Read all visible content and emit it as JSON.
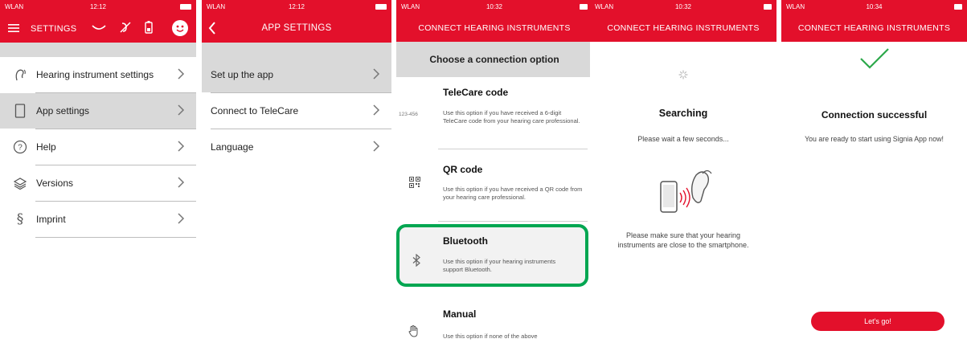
{
  "screen1": {
    "status": {
      "carrier": "WLAN",
      "time": "12:12"
    },
    "title": "SETTINGS",
    "items": [
      {
        "label": "Hearing instrument settings",
        "icon": "ear-icon"
      },
      {
        "label": "App settings",
        "icon": "phone-icon"
      },
      {
        "label": "Help",
        "icon": "help-icon"
      },
      {
        "label": "Versions",
        "icon": "layers-icon"
      },
      {
        "label": "Imprint",
        "icon": "section-icon"
      }
    ]
  },
  "screen2": {
    "status": {
      "carrier": "WLAN",
      "time": "12:12"
    },
    "title": "APP SETTINGS",
    "items": [
      {
        "label": "Set up the app"
      },
      {
        "label": "Connect to TeleCare"
      },
      {
        "label": "Language"
      }
    ]
  },
  "screen3": {
    "status": {
      "carrier": "WLAN",
      "time": "10:32"
    },
    "title": "CONNECT HEARING INSTRUMENTS",
    "subheader": "Choose a connection option",
    "options": [
      {
        "title": "TeleCare code",
        "icon_text": "123-456",
        "desc": "Use this option if you have received a 6-digit TeleCare code from your hearing care professional."
      },
      {
        "title": "QR code",
        "icon": "qr-icon",
        "desc": "Use this option if you have received a QR code from your hearing care professional."
      },
      {
        "title": "Bluetooth",
        "icon": "bluetooth-icon",
        "desc": "Use this option if your hearing instruments support Bluetooth."
      },
      {
        "title": "Manual",
        "icon": "hand-icon",
        "desc": "Use this option if none of the above"
      }
    ]
  },
  "screen4": {
    "status": {
      "carrier": "WLAN",
      "time": "10:32"
    },
    "title": "CONNECT HEARING INSTRUMENTS",
    "heading": "Searching",
    "subtext": "Please wait a few seconds...",
    "note": "Please make sure that your hearing instruments are close to the smartphone."
  },
  "screen5": {
    "status": {
      "carrier": "WLAN",
      "time": "10:34"
    },
    "title": "CONNECT HEARING INSTRUMENTS",
    "heading": "Connection successful",
    "subtext": "You are ready to start using Signia App now!",
    "button": "Let's go!"
  },
  "colors": {
    "brand": "#e3102b",
    "highlight": "#00a651",
    "selected_row": "#d9d9d9"
  }
}
